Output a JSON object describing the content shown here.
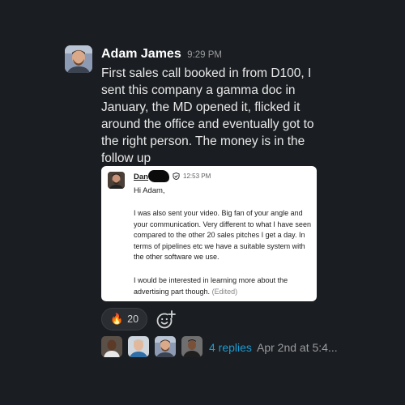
{
  "message": {
    "author": "Adam James",
    "time": "9:29 PM",
    "text": "First sales call booked in from D100, I sent this company a gamma doc in January, the MD opened it, flicked it around the office and eventually got to the right person. The money is in the follow up"
  },
  "attachment": {
    "sender_name": "Dan",
    "time": "12:53 PM",
    "greeting": "Hi Adam,",
    "paragraph1": "I was also sent your video. Big fan of your angle and your communication. Very different to what I have seen compared to the other 20 sales pitches I get a day. In terms of pipelines etc we have a suitable system with the other software we use.",
    "paragraph2": "I would be interested in learning more about the advertising part though.",
    "edited_label": "(Edited)",
    "verified_icon": "shield-check-icon"
  },
  "reactions": [
    {
      "emoji": "🔥",
      "count": "20"
    }
  ],
  "add_reaction_icon": "add-emoji-icon",
  "thread": {
    "replies": "4 replies",
    "last_reply": "Apr 2nd at 5:4..."
  }
}
